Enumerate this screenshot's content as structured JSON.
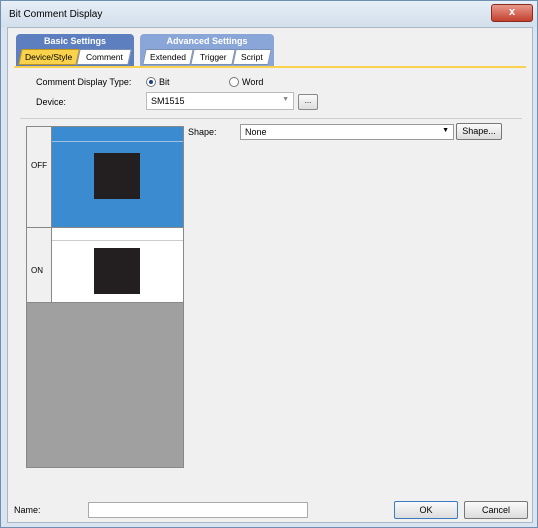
{
  "window": {
    "title": "Bit Comment Display",
    "close_glyph": "x"
  },
  "tabs": {
    "basic_label": "Basic Settings",
    "advanced_label": "Advanced Settings",
    "basic_subtabs": [
      "Device/Style",
      "Comment"
    ],
    "advanced_subtabs": [
      "Extended",
      "Trigger",
      "Script"
    ],
    "active": "Device/Style"
  },
  "form": {
    "comment_display_type_label": "Comment Display Type:",
    "bit_label": "Bit",
    "word_label": "Word",
    "selected": "Bit",
    "device_label": "Device:",
    "device_value": "SM1515",
    "ellipsis": "...",
    "shape_label": "Shape:",
    "shape_value": "None",
    "shape_button": "Shape...",
    "name_label": "Name:",
    "name_value": ""
  },
  "preview": {
    "off_label": "OFF",
    "on_label": "ON",
    "off_color": "#3a8bd0",
    "on_color": "#ffffff",
    "square_color": "#231f20"
  },
  "buttons": {
    "ok": "OK",
    "cancel": "Cancel"
  },
  "colors": {
    "active_tab": "#fbd24c",
    "basic_tab_group": "#5d7fc0",
    "advanced_tab_group": "#8aa6d8"
  }
}
